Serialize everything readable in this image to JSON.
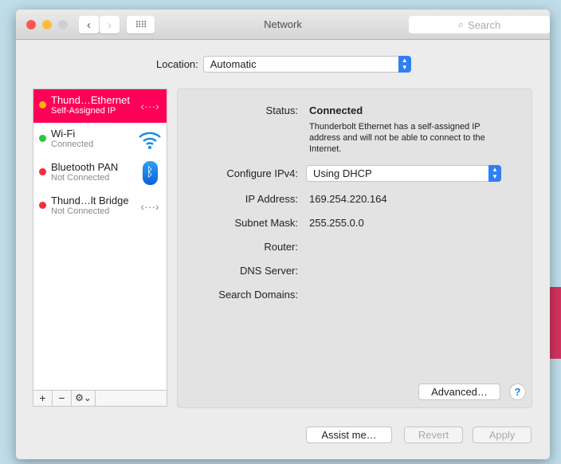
{
  "window": {
    "title": "Network",
    "search_placeholder": "Search"
  },
  "location": {
    "label": "Location:",
    "value": "Automatic"
  },
  "services": [
    {
      "name": "Thund…Ethernet",
      "status": "Self-Assigned IP",
      "dot": "#f5b400",
      "icon": "ethernet-icon",
      "selected": true
    },
    {
      "name": "Wi-Fi",
      "status": "Connected",
      "dot": "#27c93f",
      "icon": "wifi-icon"
    },
    {
      "name": "Bluetooth PAN",
      "status": "Not Connected",
      "dot": "#fc2a3c",
      "icon": "bluetooth-icon"
    },
    {
      "name": "Thund…lt Bridge",
      "status": "Not Connected",
      "dot": "#fc2a3c",
      "icon": "ethernet-icon"
    }
  ],
  "sidebar_tools": {
    "add": "+",
    "remove": "−",
    "gear": "⚙⌄"
  },
  "detail": {
    "status_label": "Status:",
    "status_value": "Connected",
    "status_desc": "Thunderbolt Ethernet has a self-assigned IP address and will not be able to connect to the Internet.",
    "configure_label": "Configure IPv4:",
    "configure_value": "Using DHCP",
    "ip_label": "IP Address:",
    "ip_value": "169.254.220.164",
    "subnet_label": "Subnet Mask:",
    "subnet_value": "255.255.0.0",
    "router_label": "Router:",
    "dns_label": "DNS Server:",
    "domains_label": "Search Domains:",
    "advanced": "Advanced…",
    "help": "?"
  },
  "footer": {
    "assist": "Assist me…",
    "revert": "Revert",
    "apply": "Apply"
  }
}
